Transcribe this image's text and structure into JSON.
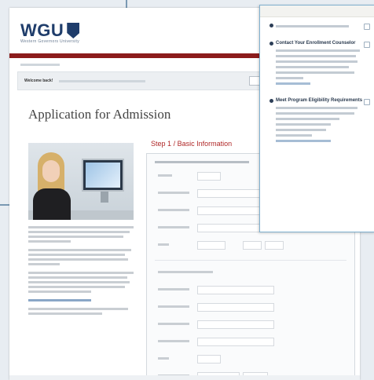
{
  "app": {
    "logo_text": "WGU",
    "logo_subtitle": "Western Governors University"
  },
  "welcome": {
    "strong": "Welcome back!",
    "sub": "",
    "select_value": ""
  },
  "page": {
    "title": "Application for Admission",
    "step_prefix": "Step",
    "step_number": "1",
    "step_label": "Basic Information"
  },
  "overlay": {
    "sections": [
      {
        "title": ""
      },
      {
        "title": "Contact Your Enrollment Counselor"
      },
      {
        "title": "Meet Program Eligibility Requirements"
      }
    ]
  }
}
